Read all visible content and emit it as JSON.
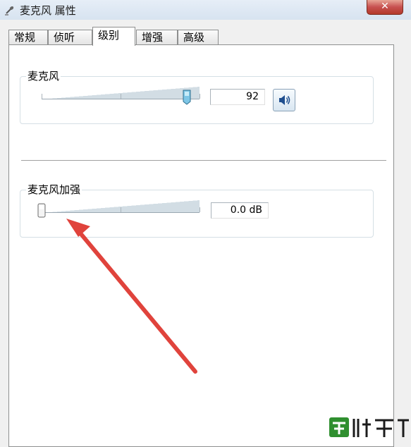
{
  "window": {
    "title": "麦克风 属性",
    "close_label": "✕"
  },
  "tabs": [
    {
      "label": "常规",
      "active": false
    },
    {
      "label": "侦听",
      "active": false
    },
    {
      "label": "级别",
      "active": true
    },
    {
      "label": "增强",
      "active": false
    },
    {
      "label": "高级",
      "active": false
    }
  ],
  "microphone": {
    "label": "麦克风",
    "value": "92",
    "level": 92
  },
  "boost": {
    "label": "麦克风加强",
    "value": "0.0 dB",
    "level": 0
  },
  "colors": {
    "annotation_arrow": "#e0433c",
    "watermark_green": "#2f8f2f"
  },
  "icons": {
    "mute": "speaker-icon",
    "title": "microphone-icon"
  }
}
